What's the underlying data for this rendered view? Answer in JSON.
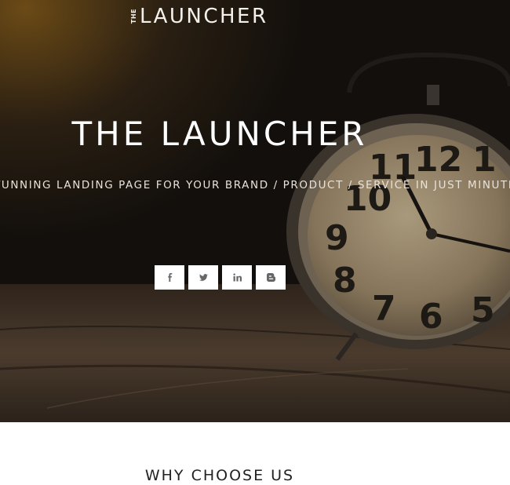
{
  "header": {
    "logo_prefix": "THE",
    "logo_main": "LAUNCHER"
  },
  "hero": {
    "title": "THE LAUNCHER",
    "subtitle": "STUNNING LANDING PAGE FOR YOUR BRAND / PRODUCT / SERVICE IN JUST MINUTES"
  },
  "social": [
    {
      "icon": "facebook-icon"
    },
    {
      "icon": "twitter-icon"
    },
    {
      "icon": "linkedin-icon"
    },
    {
      "icon": "blogger-icon"
    }
  ],
  "section": {
    "title": "WHY CHOOSE US"
  },
  "colors": {
    "hero_text": "#ffffff",
    "icon_button_bg": "#ffffff",
    "icon_color": "#666666",
    "section_text": "#222222"
  }
}
